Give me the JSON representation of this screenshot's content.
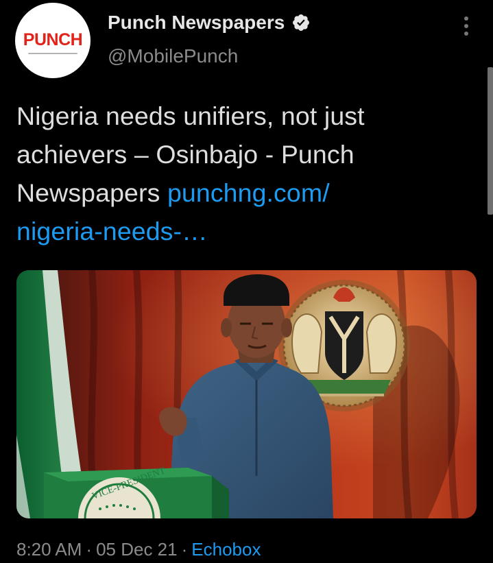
{
  "account": {
    "name": "Punch Newspapers",
    "handle": "@MobilePunch",
    "avatar_logo": "PUNCH",
    "verified": true,
    "icons": {
      "verified": "verified-badge-icon",
      "more": "more-options-icon"
    }
  },
  "tweet": {
    "text_lines": [
      "Nigeria needs unifiers, not just",
      "achievers – Osinbajo - Punch",
      "Newspapers "
    ],
    "link_part1": "punchng.com/",
    "link_part2": "nigeria-needs-…"
  },
  "media": {
    "podium_text": "VICE-PRESIDENT"
  },
  "meta": {
    "time": "8:20 AM",
    "date": "05 Dec 21",
    "separator": "·",
    "source": "Echobox"
  },
  "colors": {
    "background": "#000000",
    "link": "#1d9bf0",
    "muted": "#8b8b8b",
    "brand_red": "#e2231a"
  }
}
